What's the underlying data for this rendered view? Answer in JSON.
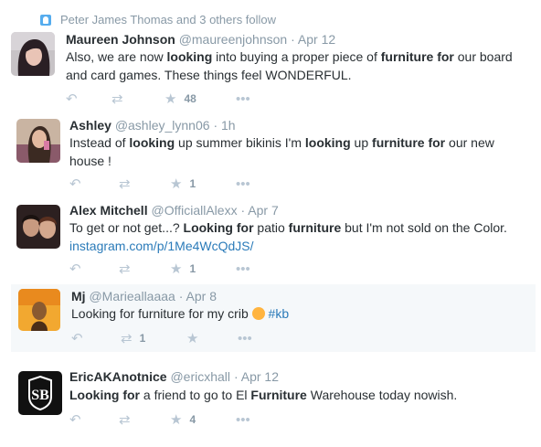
{
  "follow_note": "Peter James Thomas and 3 others follow",
  "tweets": [
    {
      "name": "Maureen Johnson",
      "handle": "@maureenjohnson",
      "time": "Apr 12",
      "line1": [
        "Also, we are now ",
        "looking",
        " into buying a proper piece of ",
        "furniture for",
        " our board"
      ],
      "line2": "and card games. These things feel WONDERFUL.",
      "like_count": "48",
      "retweet_count": ""
    },
    {
      "name": "Ashley",
      "handle": "@ashley_lynn06",
      "time": "1h",
      "line1": [
        "Instead of ",
        "looking",
        " up summer bikinis I'm ",
        "looking",
        " up ",
        "furniture for",
        " our new"
      ],
      "line2": "house !",
      "like_count": "1",
      "retweet_count": ""
    },
    {
      "name": "Alex Mitchell",
      "handle": "@OfficiallAlexx",
      "time": "Apr 7",
      "line1": [
        "To get or not get...? ",
        "Looking for",
        " patio ",
        "furniture",
        " but I'm not sold on the Color."
      ],
      "link": "instagram.com/p/1Me4WcQdJS/",
      "like_count": "1",
      "retweet_count": ""
    },
    {
      "name": "Mj",
      "handle": "@Marieallaaaa",
      "time": "Apr 8",
      "text": "Looking for furniture for my crib",
      "hashtag": "#kb",
      "like_count": "",
      "retweet_count": "1"
    },
    {
      "name": "EricAKAnotnice",
      "handle": "@ericxhall",
      "time": "Apr 12",
      "line1": [
        "Looking for",
        " a friend to go to El ",
        "Furniture",
        " Warehouse today nowish."
      ],
      "like_count": "4",
      "retweet_count": ""
    }
  ],
  "icons": {
    "reply": "reply-icon",
    "retweet": "retweet-icon",
    "like": "star-icon",
    "more": "more-icon"
  },
  "colors": {
    "name": "#292f33",
    "meta": "#8899a6",
    "link": "#2b7bb9",
    "action_icon": "#b8c6d3",
    "highlight_bg": "#f5f8fa"
  }
}
